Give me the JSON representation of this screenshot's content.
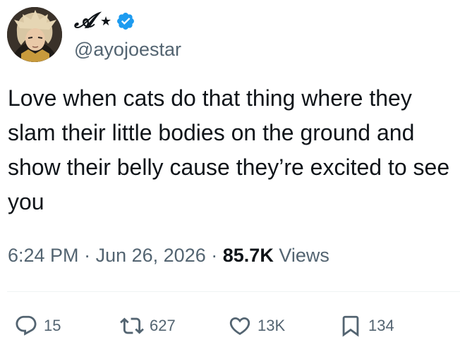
{
  "author": {
    "display_name": "𝓐",
    "badge_star": "★",
    "handle": "@ayojoestar",
    "verified_color": "#1d9bf0"
  },
  "tweet": {
    "text": "Love when cats do that thing where they slam their little bodies on the ground and show their belly cause they’re excited to see you"
  },
  "meta": {
    "time": "6:24 PM",
    "separator": "·",
    "date": "Jun 26, 2026",
    "views_count": "85.7K",
    "views_label": "Views"
  },
  "actions": {
    "reply_count": "15",
    "retweet_count": "627",
    "like_count": "13K",
    "bookmark_count": "134",
    "icons": [
      "reply-icon",
      "retweet-icon",
      "like-icon",
      "bookmark-icon"
    ]
  },
  "colors": {
    "text": "#0f1419",
    "secondary": "#536471",
    "divider": "#eff3f4",
    "accent": "#1d9bf0"
  }
}
